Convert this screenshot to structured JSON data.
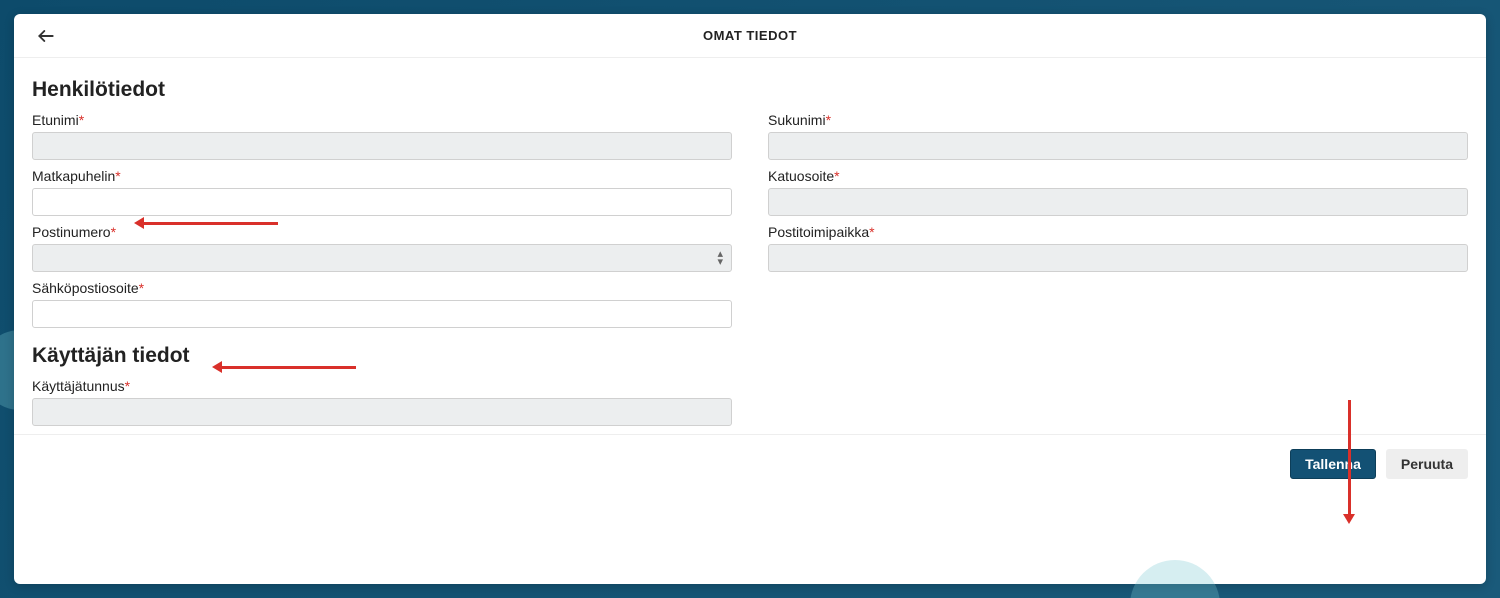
{
  "header": {
    "title": "OMAT TIEDOT"
  },
  "section1": {
    "title": "Henkilötiedot",
    "fields": {
      "etunimi": {
        "label": "Etunimi",
        "required": true
      },
      "sukunimi": {
        "label": "Sukunimi",
        "required": true
      },
      "matkapuhelin": {
        "label": "Matkapuhelin",
        "required": true
      },
      "katuosoite": {
        "label": "Katuosoite",
        "required": true
      },
      "postinumero": {
        "label": "Postinumero",
        "required": true
      },
      "postitoimipaikka": {
        "label": "Postitoimipaikka",
        "required": true
      },
      "sahkoposti": {
        "label": "Sähköpostiosoite",
        "required": true
      }
    }
  },
  "section2": {
    "title": "Käyttäjän tiedot",
    "fields": {
      "kayttajatunnus": {
        "label": "Käyttäjätunnus",
        "required": true
      }
    }
  },
  "footer": {
    "save": "Tallenna",
    "cancel": "Peruuta"
  },
  "required_marker": "*"
}
